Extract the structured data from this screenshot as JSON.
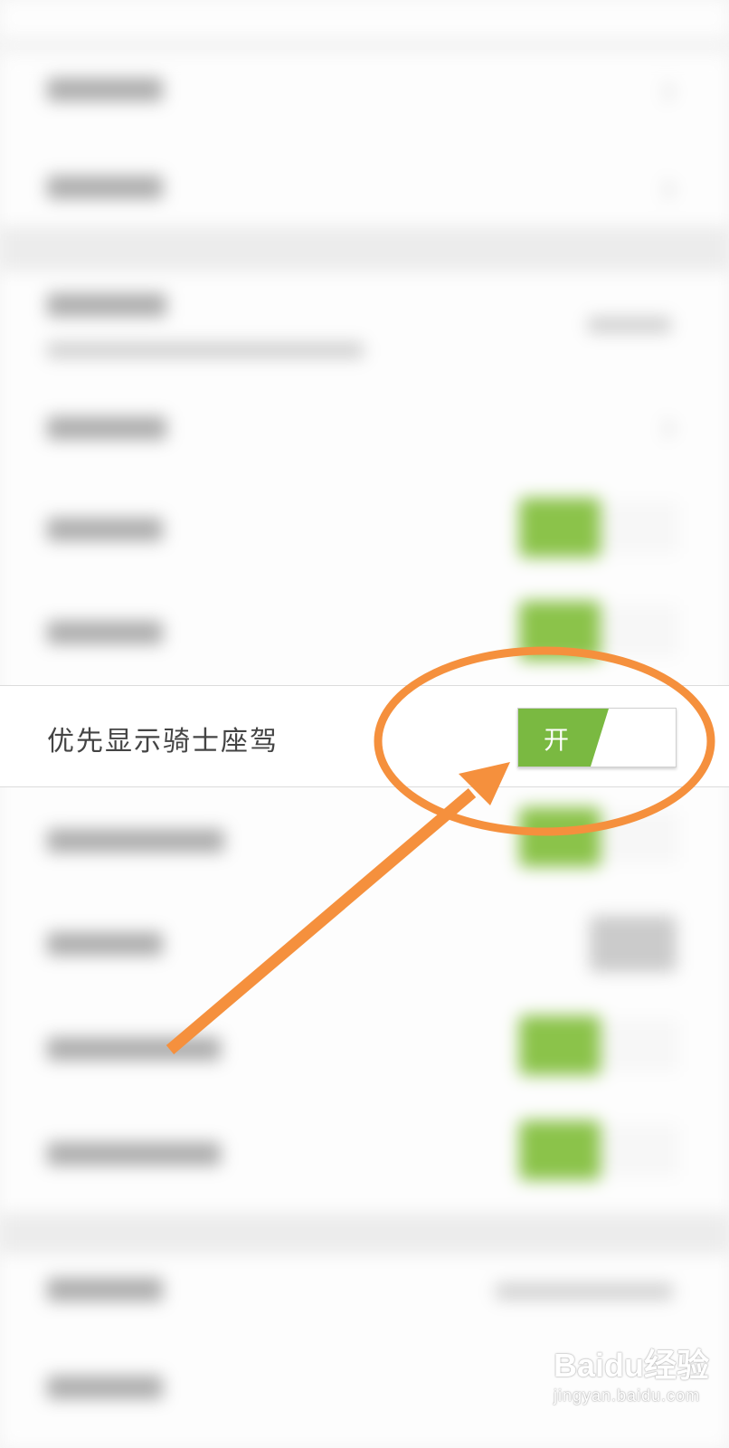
{
  "setting_row": {
    "label": "优先显示骑士座驾",
    "toggle": {
      "state": "on",
      "text": "开"
    }
  },
  "watermark": {
    "main": "Baidu经验",
    "sub": "jingyan.baidu.com"
  },
  "colors": {
    "toggle_on": "#7ab941",
    "annotation": "#f5903d",
    "background": "#f4f4f4"
  },
  "icons": [
    "chevron-right-icon",
    "paw-icon"
  ]
}
